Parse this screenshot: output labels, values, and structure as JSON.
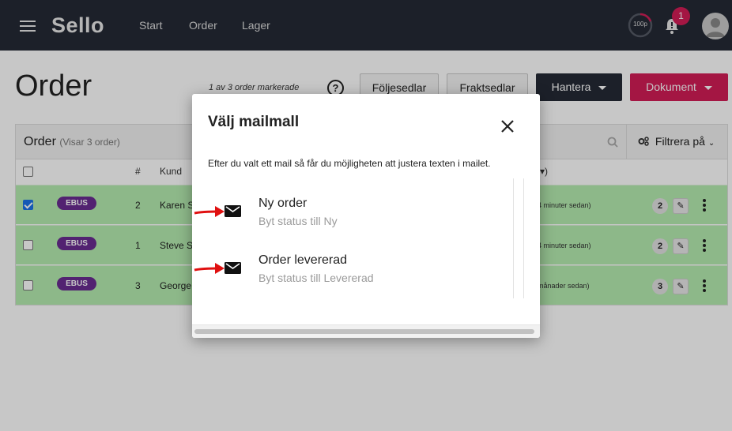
{
  "topbar": {
    "logo": "Sello",
    "nav": [
      "Start",
      "Order",
      "Lager"
    ],
    "progress_label": "100p",
    "notification_count": "1",
    "bg_color": "#252a35"
  },
  "page": {
    "title": "Order",
    "marked_text": "1 av 3 order markerade",
    "help_label": "?",
    "buttons": {
      "foljesedlar": "Följesedlar",
      "fraktsedlar": "Fraktsedlar",
      "hantera": "Hantera",
      "dokument": "Dokument"
    },
    "panel": {
      "title": "Order",
      "subtitle": "(Visar 3 order)",
      "filter_label": "Filtrera på"
    },
    "columns": {
      "number": "#",
      "customer": "Kund",
      "date_sort": "▾)"
    },
    "rows": [
      {
        "tag": "EBUS",
        "number": "2",
        "customer": "Karen S",
        "time": "4 minuter sedan)",
        "count": "2",
        "checked": true
      },
      {
        "tag": "EBUS",
        "number": "1",
        "customer": "Steve Sr",
        "time": "4 minuter sedan)",
        "count": "2",
        "checked": false
      },
      {
        "tag": "EBUS",
        "number": "3",
        "customer": "George",
        "time": "månader sedan)",
        "count": "3",
        "checked": false
      }
    ],
    "accent_pink": "#d21d56",
    "row_green": "#b5ecb0",
    "tag_purple": "#6a2c91"
  },
  "modal": {
    "title": "Välj mailmall",
    "description": "Efter du valt ett mail så får du möjligheten att justera texten i mailet.",
    "items": [
      {
        "title": "Ny order",
        "subtitle": "Byt status till Ny",
        "icon": "mail-icon"
      },
      {
        "title": "Order levererad",
        "subtitle": "Byt status till Levererad",
        "icon": "mail-icon"
      }
    ],
    "annotation_color": "#e01010"
  }
}
